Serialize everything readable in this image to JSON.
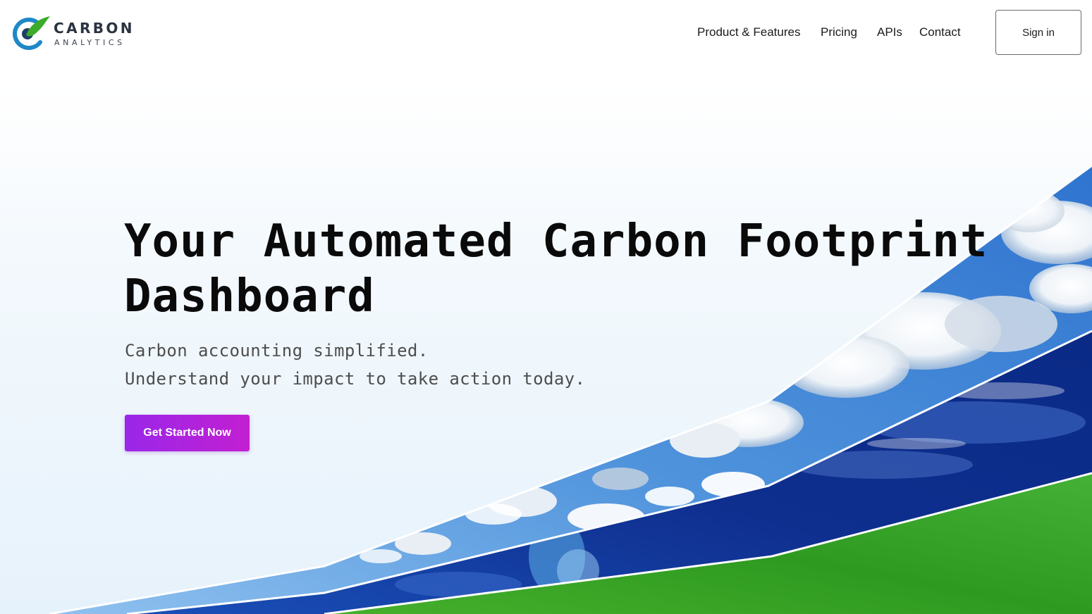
{
  "brand": {
    "name": "CARBON",
    "tagline": "ANALYTICS",
    "logo_icon": "carbon-leaf-c-logo-icon",
    "colors": {
      "ring": "#1e88c8",
      "leaf": "#3cab2a",
      "core": "#1f3f63"
    }
  },
  "nav": {
    "items": [
      {
        "label": "Product & Features"
      },
      {
        "label": "Pricing"
      },
      {
        "label": "APIs"
      },
      {
        "label": "Contact"
      }
    ],
    "signin_label": "Sign in"
  },
  "hero": {
    "title_line1": "Your Automated Carbon Footprint",
    "title_line2": "Dashboard",
    "subtitle_line1": "Carbon accounting simplified.",
    "subtitle_line2": "Understand your impact to take action today.",
    "cta_label": "Get Started Now",
    "cta_gradient": [
      "#9a27e8",
      "#c21fd1"
    ]
  },
  "illustration": {
    "bands": [
      "sky-clouds",
      "ocean-waves",
      "green-grass"
    ],
    "colors": {
      "sky": "#3f86d6",
      "ocean": "#123a9a",
      "grass": "#2f9a22"
    }
  }
}
